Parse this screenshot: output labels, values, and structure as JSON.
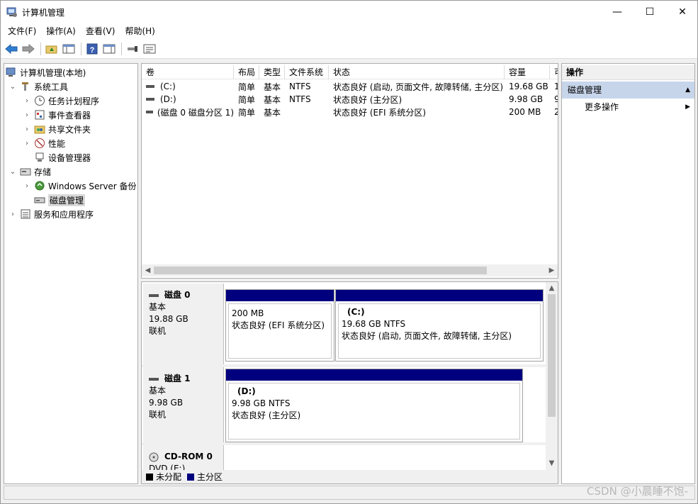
{
  "window": {
    "title": "计算机管理",
    "controls": {
      "minimize": "—",
      "maximize": "☐",
      "close": "✕"
    }
  },
  "menu": [
    {
      "label": "文件(F)"
    },
    {
      "label": "操作(A)"
    },
    {
      "label": "查看(V)"
    },
    {
      "label": "帮助(H)"
    }
  ],
  "toolbar": {
    "icons": [
      "back-arrow-icon",
      "forward-arrow-icon",
      "up-folder-icon",
      "show-hide-tree-icon",
      "help-icon",
      "show-hide-action-icon",
      "connect-icon",
      "properties-icon"
    ]
  },
  "tree": {
    "root": "计算机管理(本地)",
    "system_tools": "系统工具",
    "task_scheduler": "任务计划程序",
    "event_viewer": "事件查看器",
    "shared_folders": "共享文件夹",
    "performance": "性能",
    "device_manager": "设备管理器",
    "storage": "存储",
    "windows_server_backup": "Windows Server 备份",
    "disk_management": "磁盘管理",
    "services_apps": "服务和应用程序"
  },
  "volume_list": {
    "columns": [
      "卷",
      "布局",
      "类型",
      "文件系统",
      "状态",
      "容量",
      "可"
    ],
    "rows": [
      [
        "(C:)",
        "简单",
        "基本",
        "NTFS",
        "状态良好 (启动, 页面文件, 故障转储, 主分区)",
        "19.68 GB",
        "1"
      ],
      [
        "(D:)",
        "简单",
        "基本",
        "NTFS",
        "状态良好 (主分区)",
        "9.98 GB",
        "9"
      ],
      [
        "(磁盘 0 磁盘分区 1)",
        "简单",
        "基本",
        "",
        "状态良好 (EFI 系统分区)",
        "200 MB",
        "2"
      ]
    ]
  },
  "disks": {
    "disk0": {
      "name": "磁盘 0",
      "type": "基本",
      "size": "19.88 GB",
      "status": "联机",
      "efi": {
        "size": "200 MB",
        "status": "状态良好 (EFI 系统分区)"
      },
      "c": {
        "name": "(C:)",
        "size": "19.68 GB NTFS",
        "status": "状态良好 (启动, 页面文件, 故障转储, 主分区)"
      }
    },
    "disk1": {
      "name": "磁盘 1",
      "type": "基本",
      "size": "9.98 GB",
      "status": "联机",
      "d": {
        "name": "(D:)",
        "size": "9.98 GB NTFS",
        "status": "状态良好 (主分区)"
      }
    },
    "cdrom0": {
      "name": "CD-ROM 0",
      "type": "DVD (E:)"
    }
  },
  "legend": {
    "unallocated": "未分配",
    "primary": "主分区",
    "colors": {
      "unallocated": "#000000",
      "primary": "#00007f"
    }
  },
  "actions": {
    "header": "操作",
    "section": "磁盘管理",
    "more": "更多操作"
  },
  "watermark": "CSDN @小晨睡不饱-"
}
